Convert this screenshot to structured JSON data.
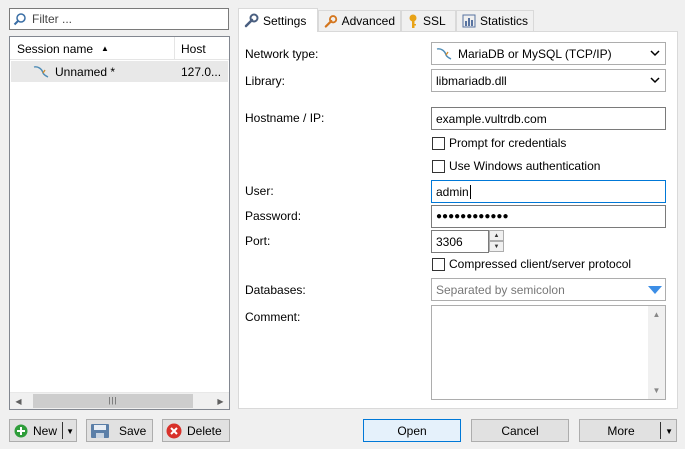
{
  "filter": {
    "placeholder": "Filter ..."
  },
  "session_list": {
    "columns": [
      "Session name",
      "Host"
    ],
    "rows": [
      {
        "name": "Unnamed *",
        "host": "127.0..."
      }
    ]
  },
  "left_buttons": {
    "new": "New",
    "save": "Save",
    "delete": "Delete"
  },
  "tabs": [
    "Settings",
    "Advanced",
    "SSL",
    "Statistics"
  ],
  "settings": {
    "network_type_label": "Network type:",
    "network_type_value": "MariaDB or MySQL (TCP/IP)",
    "library_label": "Library:",
    "library_value": "libmariadb.dll",
    "hostname_label": "Hostname / IP:",
    "hostname_value": "example.vultrdb.com",
    "prompt_credentials": "Prompt for credentials",
    "windows_auth": "Use Windows authentication",
    "user_label": "User:",
    "user_value": "admin",
    "password_label": "Password:",
    "password_value": "●●●●●●●●●●●●",
    "port_label": "Port:",
    "port_value": "3306",
    "compressed": "Compressed client/server protocol",
    "databases_label": "Databases:",
    "databases_placeholder": "Separated by semicolon",
    "comment_label": "Comment:"
  },
  "bottom_buttons": {
    "open": "Open",
    "cancel": "Cancel",
    "more": "More"
  },
  "colors": {
    "accent": "#0078d7",
    "dropdown_arrow": "#3c8ee6"
  }
}
